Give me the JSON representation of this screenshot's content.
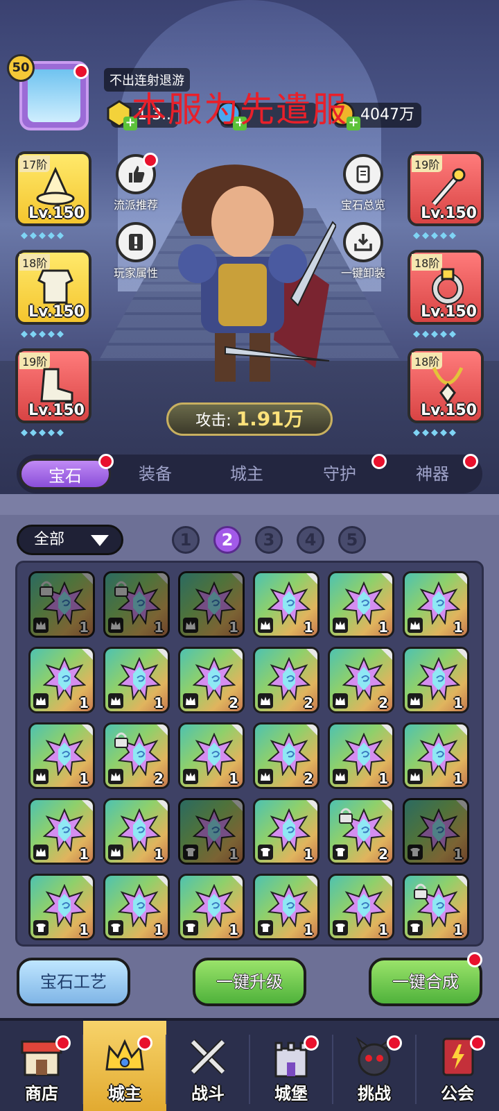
{
  "profile": {
    "level": "50",
    "name": "不出连射退游"
  },
  "server_notice": "本服为先遣服",
  "currencies": [
    {
      "amount": "1.3.. ",
      "icon": "gold-gem-icon"
    },
    {
      "amount": "",
      "icon": "blue-crystal-icon"
    },
    {
      "amount": "4047万",
      "icon": "gold-coin-icon"
    }
  ],
  "gear_left": [
    {
      "tier": "17阶",
      "level": "Lv.150",
      "item": "wizard-hat-icon"
    },
    {
      "tier": "18阶",
      "level": "Lv.150",
      "item": "armor-icon"
    },
    {
      "tier": "19阶",
      "level": "Lv.150",
      "item": "boots-icon"
    }
  ],
  "gear_right": [
    {
      "tier": "19阶",
      "level": "Lv.150",
      "item": "staff-icon"
    },
    {
      "tier": "18阶",
      "level": "Lv.150",
      "item": "ring-icon"
    },
    {
      "tier": "18阶",
      "level": "Lv.150",
      "item": "necklace-icon"
    }
  ],
  "side_buttons": {
    "left": [
      {
        "label": "流派推荐"
      },
      {
        "label": "玩家属性"
      }
    ],
    "right": [
      {
        "label": "宝石总览"
      },
      {
        "label": "一键卸装"
      }
    ]
  },
  "attack": {
    "label": "攻击:",
    "value": "1.91万"
  },
  "tabs": [
    {
      "label": "宝石",
      "active": true
    },
    {
      "label": "装备"
    },
    {
      "label": "城主"
    },
    {
      "label": "守护"
    },
    {
      "label": "神器"
    }
  ],
  "filter": {
    "label": "全部"
  },
  "pages": [
    "1",
    "2",
    "3",
    "4",
    "5"
  ],
  "active_page": "2",
  "gems": [
    {
      "count": "1",
      "locked": true,
      "dim": true,
      "badge": "crown"
    },
    {
      "count": "1",
      "locked": true,
      "dim": true,
      "badge": "crown"
    },
    {
      "count": "1",
      "dim": true,
      "badge": "crown"
    },
    {
      "count": "1",
      "badge": "crown"
    },
    {
      "count": "1",
      "badge": "crown"
    },
    {
      "count": "1",
      "badge": "crown"
    },
    {
      "count": "1",
      "badge": "crown"
    },
    {
      "count": "1",
      "badge": "crown"
    },
    {
      "count": "2",
      "badge": "crown"
    },
    {
      "count": "2",
      "badge": "crown"
    },
    {
      "count": "2",
      "badge": "crown"
    },
    {
      "count": "1",
      "badge": "crown"
    },
    {
      "count": "1",
      "badge": "crown"
    },
    {
      "count": "2",
      "locked": true,
      "badge": "crown"
    },
    {
      "count": "1",
      "badge": "crown"
    },
    {
      "count": "2",
      "badge": "crown"
    },
    {
      "count": "1",
      "badge": "crown"
    },
    {
      "count": "1",
      "badge": "crown"
    },
    {
      "count": "1",
      "badge": "crown"
    },
    {
      "count": "1",
      "badge": "crown"
    },
    {
      "count": "1",
      "dim": true,
      "badge": "shirt"
    },
    {
      "count": "1",
      "badge": "shirt"
    },
    {
      "count": "2",
      "locked": true,
      "badge": "shirt"
    },
    {
      "count": "1",
      "dim": true,
      "badge": "shirt"
    },
    {
      "count": "1",
      "badge": "shirt"
    },
    {
      "count": "1",
      "badge": "shirt"
    },
    {
      "count": "1",
      "badge": "shirt"
    },
    {
      "count": "1",
      "badge": "shirt"
    },
    {
      "count": "1",
      "badge": "shirt"
    },
    {
      "count": "1",
      "locked": true,
      "badge": "shirt"
    }
  ],
  "actions": [
    {
      "label": "宝石工艺"
    },
    {
      "label": "一键升级"
    },
    {
      "label": "一键合成"
    }
  ],
  "nav": [
    {
      "label": "商店",
      "icon": "shop-icon"
    },
    {
      "label": "城主",
      "icon": "crown-icon",
      "active": true
    },
    {
      "label": "战斗",
      "icon": "crossed-swords-icon"
    },
    {
      "label": "城堡",
      "icon": "castle-icon"
    },
    {
      "label": "挑战",
      "icon": "demon-icon"
    },
    {
      "label": "公会",
      "icon": "guild-book-icon"
    }
  ]
}
